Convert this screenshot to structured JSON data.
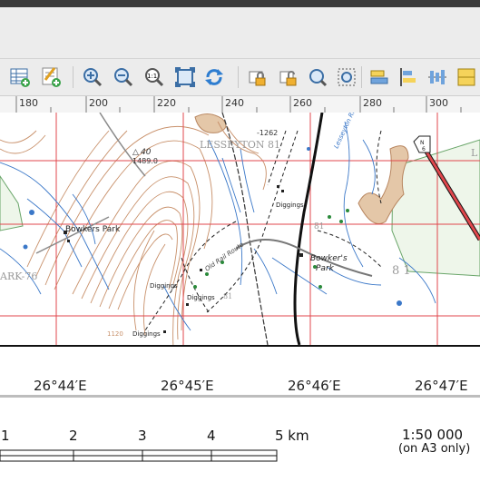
{
  "toolbar": {
    "icons": [
      "attribute-table-icon",
      "field-calculator-icon",
      "zoom-in-icon",
      "zoom-out-icon",
      "zoom-actual-icon",
      "zoom-full-icon",
      "refresh-icon",
      "lock-icon",
      "unlock-icon",
      "select-icon",
      "select-all-icon",
      "align-icon",
      "distribute-icon",
      "resize-icon",
      "more-icon"
    ]
  },
  "ruler": {
    "labels": [
      "180",
      "200",
      "220",
      "240",
      "260",
      "280",
      "300"
    ]
  },
  "map": {
    "labels": {
      "lesseyton": "LESSEYTON 81",
      "spot_height": "1489.0",
      "trig": "40",
      "bowkers_park_left": "Bowkers Park",
      "bowkers_park_right": "Bowker's",
      "park": "Park",
      "diggings_1": "Diggings",
      "diggings_2": "Diggings",
      "diggings_3": "Diggings",
      "diggings_4": "Diggings",
      "ark76": "ARK-76",
      "old_rail": "Old Rail Route",
      "height_1262": "-1262",
      "height_1120": "1120",
      "road_n6": "N\n6",
      "eighty_one": "8 1",
      "eighty_one_small": "81",
      "eighty_one_mid": "81",
      "lesseyton_river": "Lesseyton Ri",
      "l_edge": "L"
    }
  },
  "lower": {
    "longitudes": [
      "26°44′E",
      "26°45′E",
      "26°46′E",
      "26°47′E"
    ],
    "scale_numbers": [
      "1",
      "2",
      "3",
      "4",
      "5 km"
    ],
    "scale_ratio": "1:50 000",
    "scale_note": "(on A3 only)"
  },
  "colors": {
    "toolbar_bg": "#ececec",
    "grid_red": "#e0474c",
    "contour_brown": "#c8906a",
    "water_blue": "#3b78c8",
    "forest_green": "#6aa66a"
  }
}
